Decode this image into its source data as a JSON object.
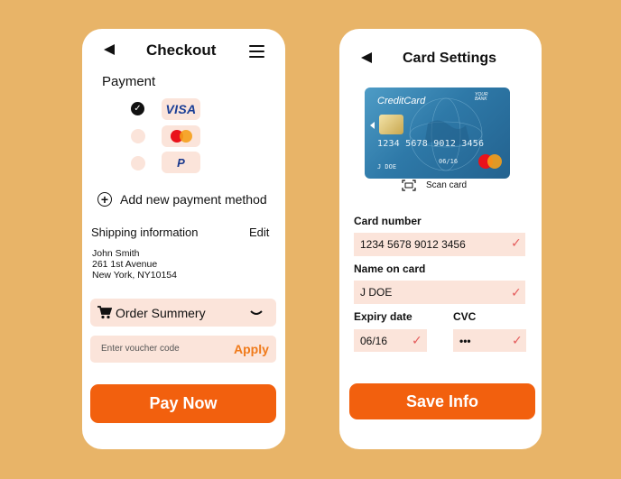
{
  "checkout": {
    "title": "Checkout",
    "payment_label": "Payment",
    "methods": [
      {
        "name": "VISA",
        "selected": true
      },
      {
        "name": "mastercard",
        "selected": false
      },
      {
        "name": "P",
        "selected": false
      }
    ],
    "add_method_label": "Add new payment method",
    "shipping_label": "Shipping information",
    "edit_label": "Edit",
    "address": [
      "John Smith",
      "261 1st Avenue",
      "New York, NY10154"
    ],
    "order_summary_label": "Order Summery",
    "voucher_placeholder": "Enter voucher code",
    "apply_label": "Apply",
    "pay_button": "Pay Now"
  },
  "card_settings": {
    "title": "Card Settings",
    "card": {
      "brand": "CreditCard",
      "bank": "YOUR BANK",
      "number": "1234 5678 9012 3456",
      "holder": "J DOE",
      "expiry": "06/16"
    },
    "scan_label": "Scan card",
    "fields": {
      "card_number_label": "Card number",
      "card_number_value": "1234 5678 9012 3456",
      "name_label": "Name on card",
      "name_value": "J DOE",
      "expiry_label": "Expiry date",
      "expiry_value": "06/16",
      "cvc_label": "CVC",
      "cvc_value": "•••"
    },
    "save_button": "Save Info"
  },
  "colors": {
    "background": "#E8B468",
    "accent": "#F2600E",
    "field_bg": "#FBE4DA",
    "check_mark": "#E45B5B"
  }
}
